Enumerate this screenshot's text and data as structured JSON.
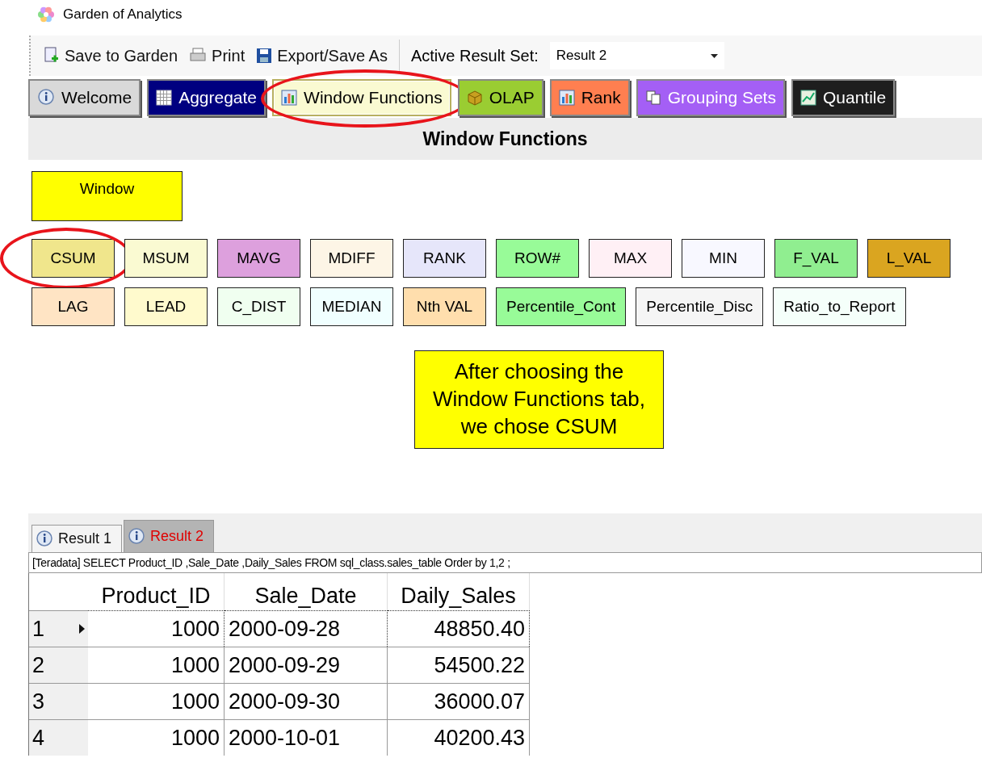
{
  "window": {
    "title": "Garden of Analytics"
  },
  "toolbar": {
    "buttons": [
      {
        "label": "Save to Garden"
      },
      {
        "label": "Print"
      },
      {
        "label": "Export/Save As"
      }
    ],
    "active_result_set": {
      "label": "Active Result Set:",
      "value": "Result 2"
    }
  },
  "tabs": [
    {
      "label": "Welcome",
      "selected": false,
      "highlighted": false,
      "color": "#d9d9d9"
    },
    {
      "label": "Aggregate",
      "selected": false,
      "highlighted": false,
      "color": "#000080"
    },
    {
      "label": "Window Functions",
      "selected": true,
      "highlighted": true,
      "color": "#fafad2"
    },
    {
      "label": "OLAP",
      "selected": false,
      "highlighted": false,
      "color": "#9acd32"
    },
    {
      "label": "Rank",
      "selected": false,
      "highlighted": false,
      "color": "#ff7f50"
    },
    {
      "label": "Grouping Sets",
      "selected": false,
      "highlighted": false,
      "color": "#a45ff5"
    },
    {
      "label": "Quantile",
      "selected": false,
      "highlighted": false,
      "color": "#1e1e1e"
    }
  ],
  "section_title": "Window Functions",
  "category_button": {
    "label": "Window",
    "color": "#ffff00"
  },
  "function_rows": [
    [
      {
        "label": "CSUM",
        "color": "#f0e68c",
        "highlighted": true
      },
      {
        "label": "MSUM",
        "color": "#fafad2",
        "highlighted": false
      },
      {
        "label": "MAVG",
        "color": "#dda0dd",
        "highlighted": false
      },
      {
        "label": "MDIFF",
        "color": "#fdf5e6",
        "highlighted": false
      },
      {
        "label": "RANK",
        "color": "#e6e6fa",
        "highlighted": false
      },
      {
        "label": "ROW#",
        "color": "#98fb98",
        "highlighted": false
      },
      {
        "label": "MAX",
        "color": "#fff0f5",
        "highlighted": false
      },
      {
        "label": "MIN",
        "color": "#f8f8ff",
        "highlighted": false
      },
      {
        "label": "F_VAL",
        "color": "#90ee90",
        "highlighted": false
      },
      {
        "label": "L_VAL",
        "color": "#daa520",
        "highlighted": false
      }
    ],
    [
      {
        "label": "LAG",
        "color": "#ffe4c4",
        "highlighted": false
      },
      {
        "label": "LEAD",
        "color": "#fffacd",
        "highlighted": false
      },
      {
        "label": "C_DIST",
        "color": "#f0fff0",
        "highlighted": false
      },
      {
        "label": "MEDIAN",
        "color": "#f0ffff",
        "highlighted": false
      },
      {
        "label": "Nth VAL",
        "color": "#ffdead",
        "highlighted": false
      },
      {
        "label": "Percentile_Cont",
        "color": "#98fb98",
        "highlighted": false
      },
      {
        "label": "Percentile_Disc",
        "color": "#f5f5f5",
        "highlighted": false
      },
      {
        "label": "Ratio_to_Report",
        "color": "#f5fffa",
        "highlighted": false
      }
    ]
  ],
  "callout": "After choosing the Window Functions tab, we chose CSUM",
  "result_tabs": [
    {
      "label": "Result 1",
      "selected": false
    },
    {
      "label": "Result 2",
      "selected": true
    }
  ],
  "query": "[Teradata] SELECT Product_ID ,Sale_Date ,Daily_Sales FROM sql_class.sales_table Order by 1,2 ;",
  "table": {
    "columns": [
      "Product_ID",
      "Sale_Date",
      "Daily_Sales"
    ],
    "rows": [
      {
        "number": "1",
        "selected": true,
        "cells": [
          "1000",
          "2000-09-28",
          "48850.40"
        ]
      },
      {
        "number": "2",
        "selected": false,
        "cells": [
          "1000",
          "2000-09-29",
          "54500.22"
        ]
      },
      {
        "number": "3",
        "selected": false,
        "cells": [
          "1000",
          "2000-09-30",
          "36000.07"
        ]
      },
      {
        "number": "4",
        "selected": false,
        "cells": [
          "1000",
          "2000-10-01",
          "40200.43"
        ]
      }
    ]
  }
}
